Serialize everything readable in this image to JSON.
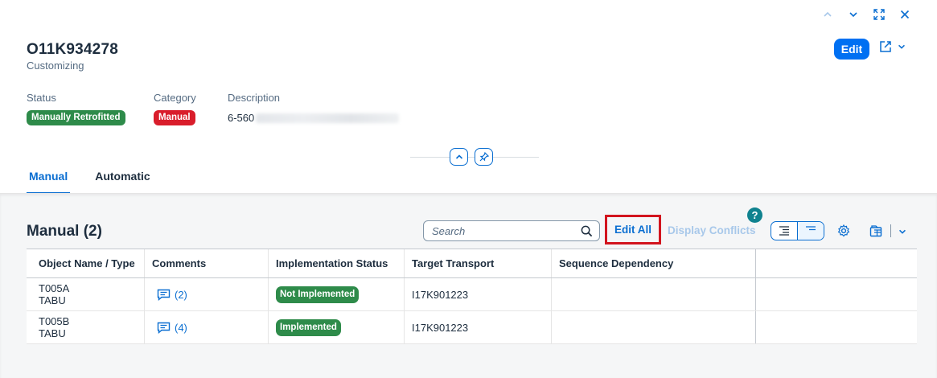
{
  "header": {
    "title": "O11K934278",
    "subtitle": "Customizing",
    "edit_label": "Edit"
  },
  "attributes": {
    "status": {
      "label": "Status",
      "value": "Manually Retrofitted",
      "color": "#2e8b4a"
    },
    "category": {
      "label": "Category",
      "value": "Manual",
      "color": "#d91d2b"
    },
    "description": {
      "label": "Description",
      "value": "6-560"
    }
  },
  "tabs": [
    {
      "label": "Manual",
      "active": true
    },
    {
      "label": "Automatic",
      "active": false
    }
  ],
  "section": {
    "title": "Manual (2)",
    "search_placeholder": "Search",
    "edit_all_label": "Edit All",
    "display_conflicts_label": "Display Conflicts",
    "help_label": "?"
  },
  "table": {
    "columns": [
      "Object Name / Type",
      "Comments",
      "Implementation Status",
      "Target Transport",
      "Sequence Dependency"
    ],
    "rows": [
      {
        "name": "T005A",
        "type": "TABU",
        "comments": "(2)",
        "status": "Not Implemented",
        "transport": "I17K901223",
        "dependency": ""
      },
      {
        "name": "T005B",
        "type": "TABU",
        "comments": "(4)",
        "status": "Implemented",
        "transport": "I17K901223",
        "dependency": ""
      }
    ]
  },
  "colors": {
    "accent": "#0a6ed1",
    "primary_button": "#0070f2",
    "highlight_frame": "#d2141e",
    "help": "#0f828f"
  }
}
